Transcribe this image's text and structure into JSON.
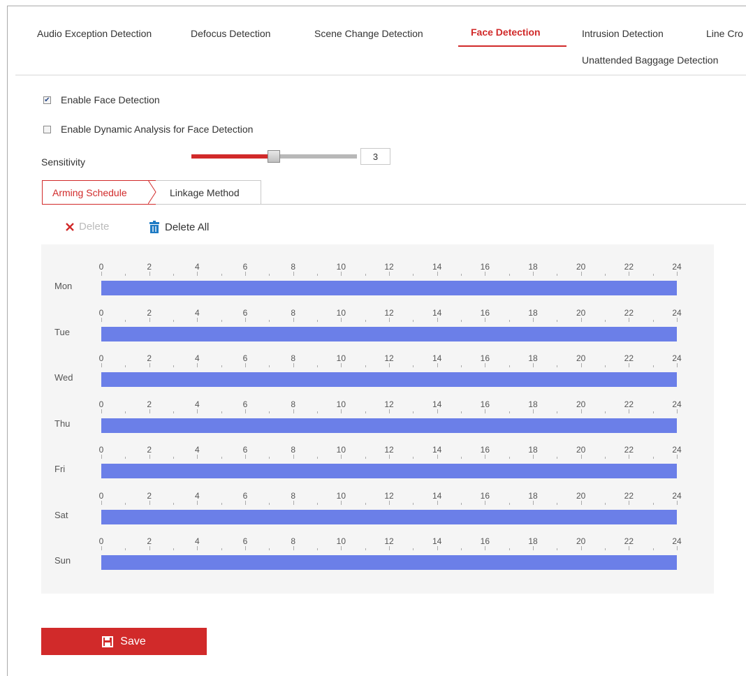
{
  "tabs": [
    {
      "label": "Audio Exception Detection",
      "active": false
    },
    {
      "label": "Defocus Detection",
      "active": false
    },
    {
      "label": "Scene Change Detection",
      "active": false
    },
    {
      "label": "Face Detection",
      "active": true
    },
    {
      "label": "Intrusion Detection",
      "active": false
    },
    {
      "label": "Line Cro",
      "active": false
    },
    {
      "label": "Unattended Baggage Detection",
      "active": false
    }
  ],
  "options": {
    "enable_face_detection": {
      "label": "Enable Face Detection",
      "checked": true
    },
    "enable_dynamic_analysis": {
      "label": "Enable Dynamic Analysis for Face Detection",
      "checked": false
    }
  },
  "sensitivity": {
    "label": "Sensitivity",
    "value": "3",
    "level": 0.5
  },
  "subtabs": {
    "arming": "Arming Schedule",
    "linkage": "Linkage Method"
  },
  "toolbar": {
    "delete": "Delete",
    "delete_all": "Delete All"
  },
  "schedule": {
    "hour_labels": [
      "0",
      "2",
      "4",
      "6",
      "8",
      "10",
      "12",
      "14",
      "16",
      "18",
      "20",
      "22",
      "24"
    ],
    "days": [
      {
        "label": "Mon",
        "start": 0,
        "end": 24
      },
      {
        "label": "Tue",
        "start": 0,
        "end": 24
      },
      {
        "label": "Wed",
        "start": 0,
        "end": 24
      },
      {
        "label": "Thu",
        "start": 0,
        "end": 24
      },
      {
        "label": "Fri",
        "start": 0,
        "end": 24
      },
      {
        "label": "Sat",
        "start": 0,
        "end": 24
      },
      {
        "label": "Sun",
        "start": 0,
        "end": 24
      }
    ]
  },
  "save": {
    "label": "Save"
  },
  "colors": {
    "accent": "#d12a2a",
    "schedule_bar": "#6b7fe8",
    "delete_icon": "#d12a2a",
    "trash_icon": "#1e7bc4"
  }
}
